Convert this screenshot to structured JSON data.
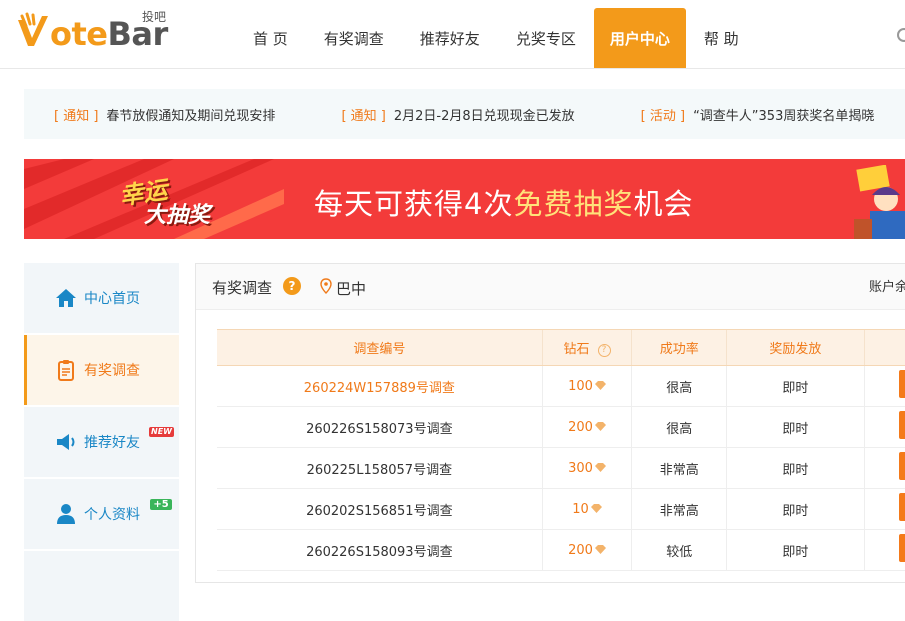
{
  "header": {
    "logo_word_v": "V",
    "logo_word_o": "ote",
    "logo_word_bar": "Bar",
    "logo_cn": "投吧",
    "nav": [
      {
        "label": "首 页"
      },
      {
        "label": "有奖调查"
      },
      {
        "label": "推荐好友"
      },
      {
        "label": "兑奖专区"
      },
      {
        "label": "用户中心"
      },
      {
        "label": "帮 助"
      }
    ],
    "active_nav": "用户中心"
  },
  "notices": [
    {
      "tag": "[ 通知 ]",
      "text": "春节放假通知及期间兑现安排"
    },
    {
      "tag": "[ 通知 ]",
      "text": "2月2日-2月8日兑现现金已发放"
    },
    {
      "tag": "[ 活动 ]",
      "text": "“调查牛人”353周获奖名单揭晓"
    }
  ],
  "banner": {
    "badge_top": "幸运",
    "badge_bottom": "大抽奖",
    "slogan_pre": "每天可获得4次",
    "slogan_highlight": "免费抽奖",
    "slogan_post": "机会"
  },
  "sidebar": {
    "items": [
      {
        "label": "中心首页"
      },
      {
        "label": "有奖调查"
      },
      {
        "label": "推荐好友",
        "badge": "NEW"
      },
      {
        "label": "个人资料",
        "badge": "+5"
      }
    ]
  },
  "panel": {
    "title": "有奖调查",
    "help": "?",
    "location": "巴中",
    "account": "账户余",
    "columns": {
      "id": "调查编号",
      "diamond": "钻石",
      "diamond_help": "?",
      "rate": "成功率",
      "reward": "奖励发放"
    },
    "rows": [
      {
        "id": "260224W157889号调查",
        "diamond": "100",
        "rate": "很高",
        "reward": "即时"
      },
      {
        "id": "260226S158073号调查",
        "diamond": "200",
        "rate": "很高",
        "reward": "即时"
      },
      {
        "id": "260225L158057号调查",
        "diamond": "300",
        "rate": "非常高",
        "reward": "即时"
      },
      {
        "id": "260202S156851号调查",
        "diamond": "10",
        "rate": "非常高",
        "reward": "即时"
      },
      {
        "id": "260226S158093号调查",
        "diamond": "200",
        "rate": "较低",
        "reward": "即时"
      }
    ]
  },
  "colors": {
    "accent": "#f39a1a",
    "link_blue": "#1a87c6",
    "banner_red": "#f33b3a"
  }
}
